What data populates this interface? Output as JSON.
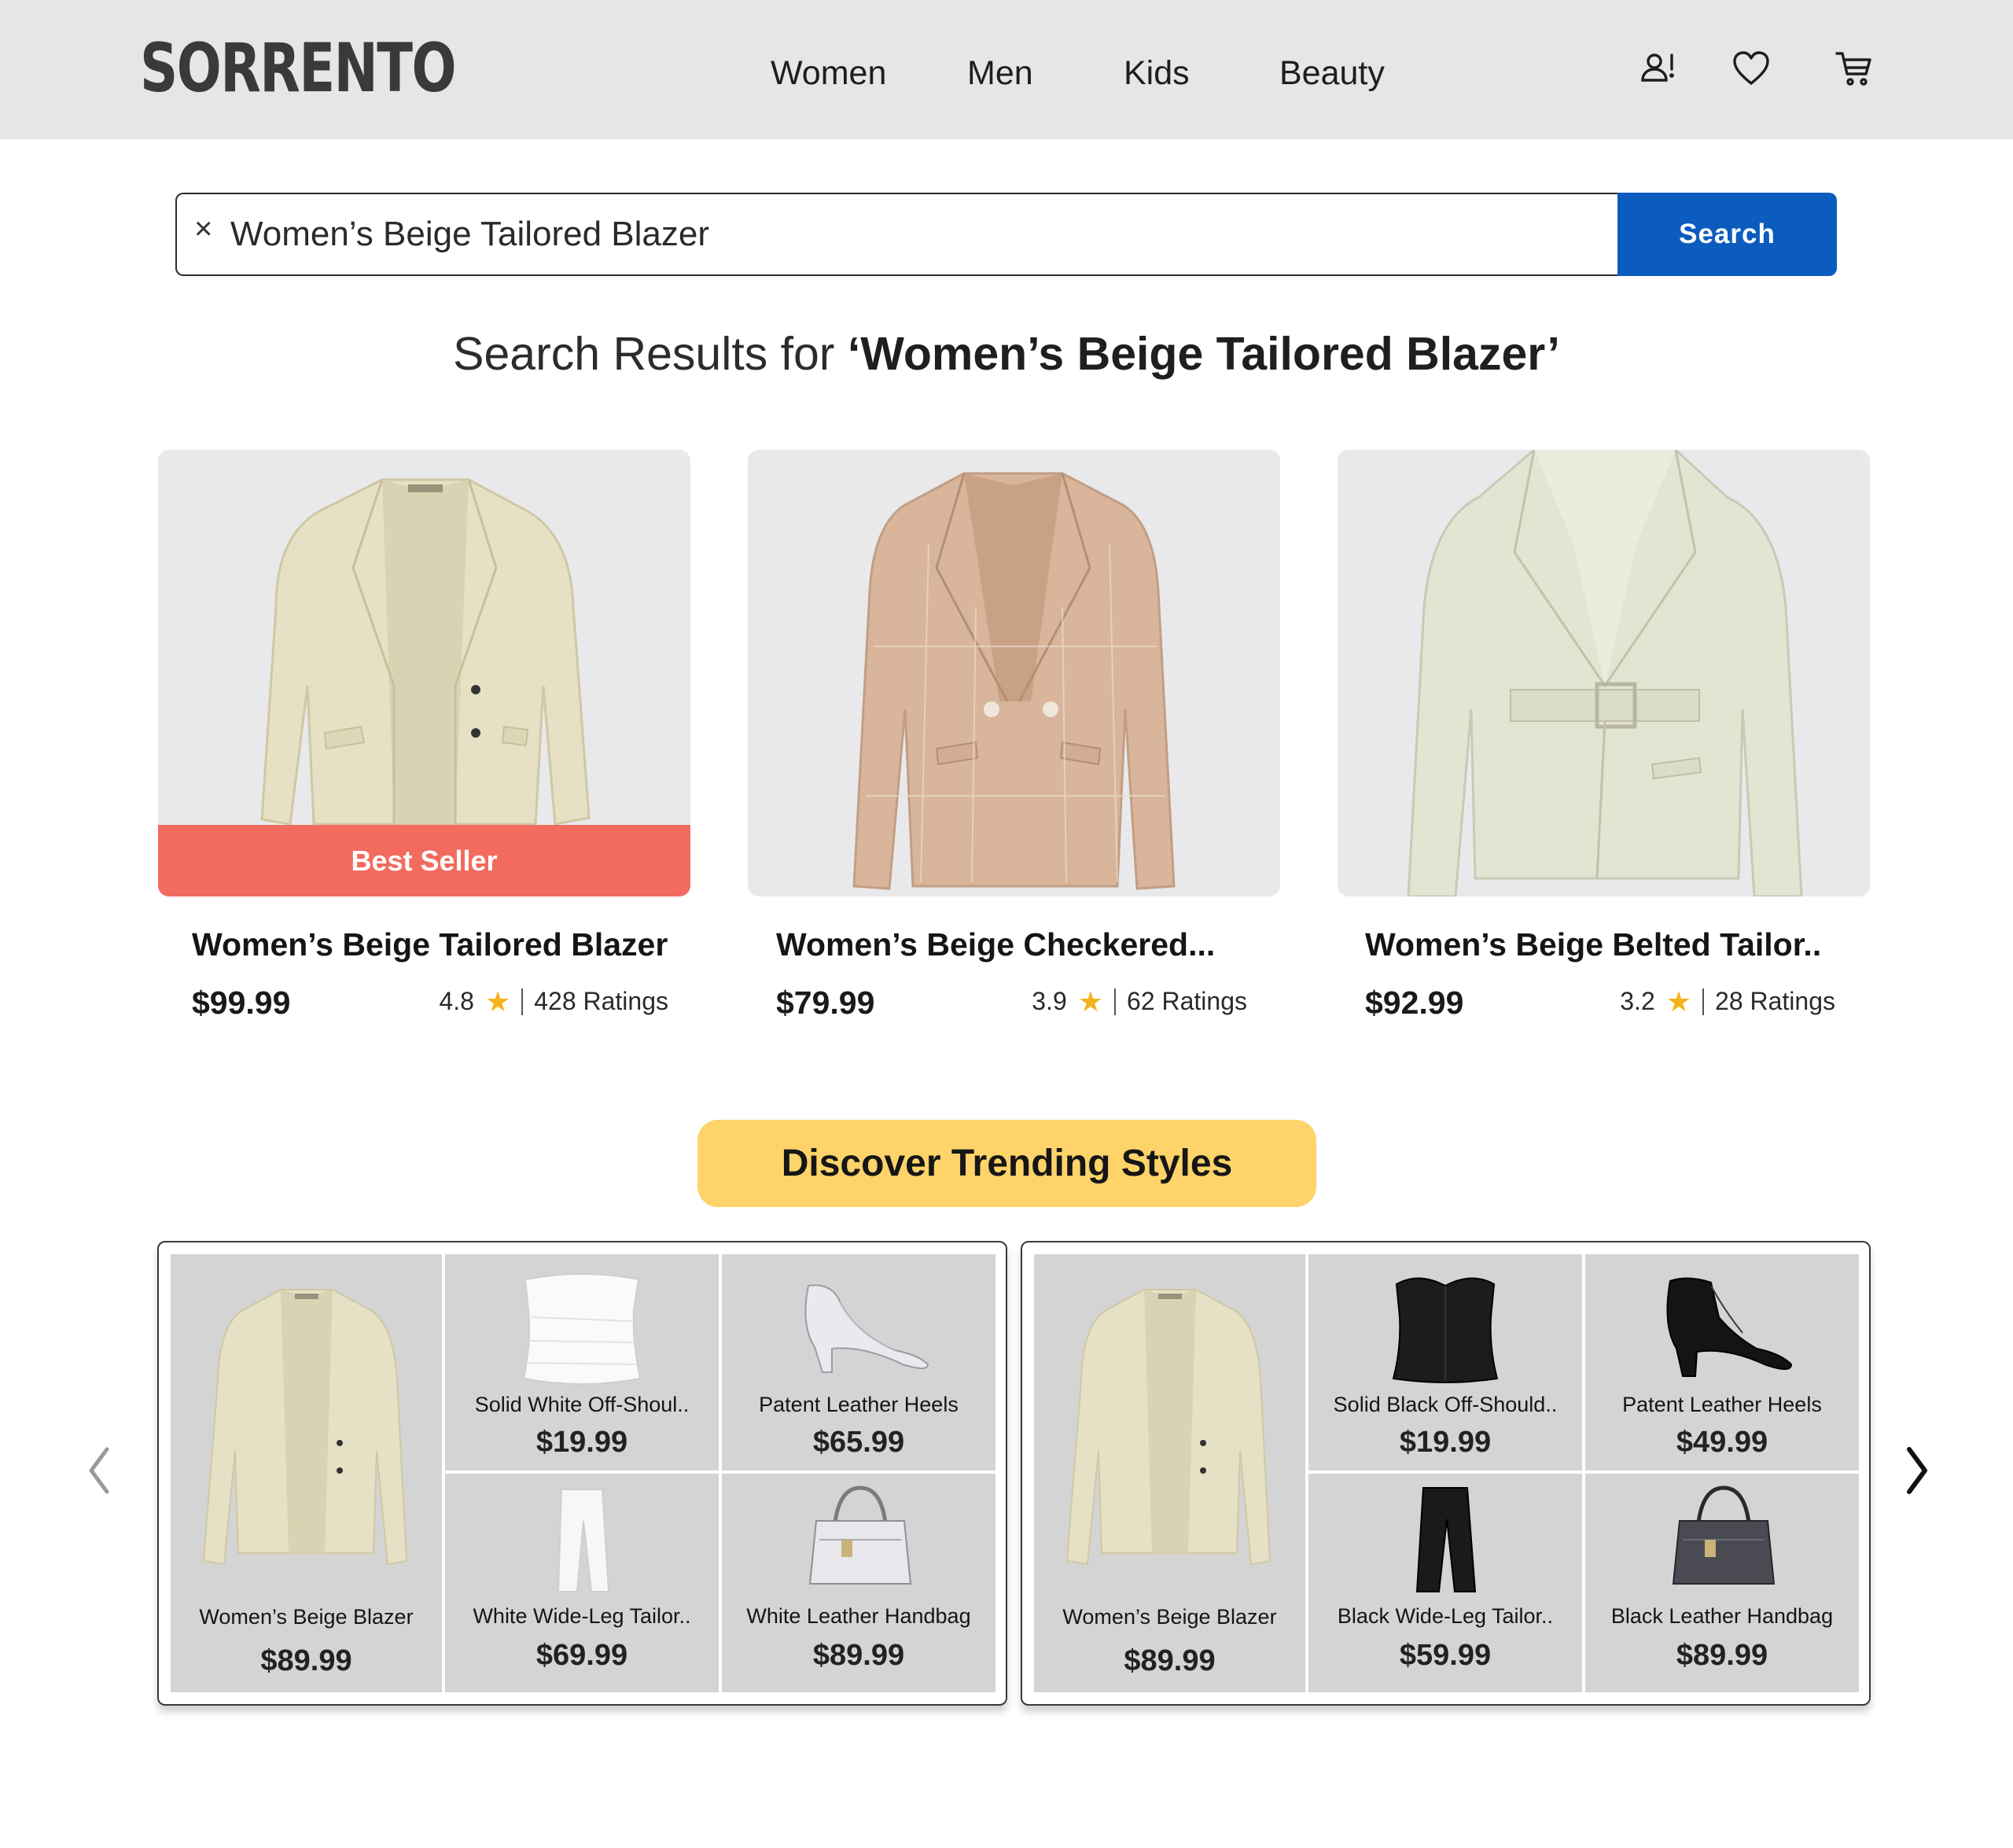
{
  "header": {
    "logo": "SORRENTO",
    "nav": [
      "Women",
      "Men",
      "Kids",
      "Beauty"
    ],
    "icons": [
      "account-alert-icon",
      "heart-icon",
      "cart-icon"
    ]
  },
  "search": {
    "value": "Women’s Beige Tailored Blazer",
    "clear_label": "×",
    "button_label": "Search"
  },
  "results": {
    "title_prefix": "Search Results for ",
    "title_query": "‘Women’s Beige Tailored Blazer’"
  },
  "products": [
    {
      "name": "Women’s Beige Tailored Blazer",
      "price": "$99.99",
      "rating": "4.8",
      "ratings_count": "428 Ratings",
      "badge": "Best Seller"
    },
    {
      "name": "Women’s Beige Checkered...",
      "price": "$79.99",
      "rating": "3.9",
      "ratings_count": "62 Ratings"
    },
    {
      "name": "Women’s Beige Belted Tailor..",
      "price": "$92.99",
      "rating": "3.2",
      "ratings_count": "28 Ratings"
    }
  ],
  "trending": {
    "title": "Discover Trending Styles",
    "sets": [
      {
        "items": [
          {
            "name": "Women’s Beige Blazer",
            "price": "$89.99"
          },
          {
            "name": "Solid White Off-Shoul..",
            "price": "$19.99"
          },
          {
            "name": "Patent Leather Heels",
            "price": "$65.99"
          },
          {
            "name": "White Wide-Leg Tailor..",
            "price": "$69.99"
          },
          {
            "name": "White Leather Handbag",
            "price": "$89.99"
          }
        ]
      },
      {
        "items": [
          {
            "name": "Women’s Beige Blazer",
            "price": "$89.99"
          },
          {
            "name": "Solid Black Off-Should..",
            "price": "$19.99"
          },
          {
            "name": "Patent Leather Heels",
            "price": "$49.99"
          },
          {
            "name": "Black Wide-Leg Tailor..",
            "price": "$59.99"
          },
          {
            "name": "Black Leather Handbag",
            "price": "$89.99"
          }
        ]
      }
    ]
  },
  "colors": {
    "header_bg": "#e6e6e6",
    "search_button": "#0c5bbf",
    "best_seller_badge": "#f26b5e",
    "trending_button": "#fdd36a",
    "star": "#f4b31d",
    "tile_bg": "#d4d4d4"
  }
}
